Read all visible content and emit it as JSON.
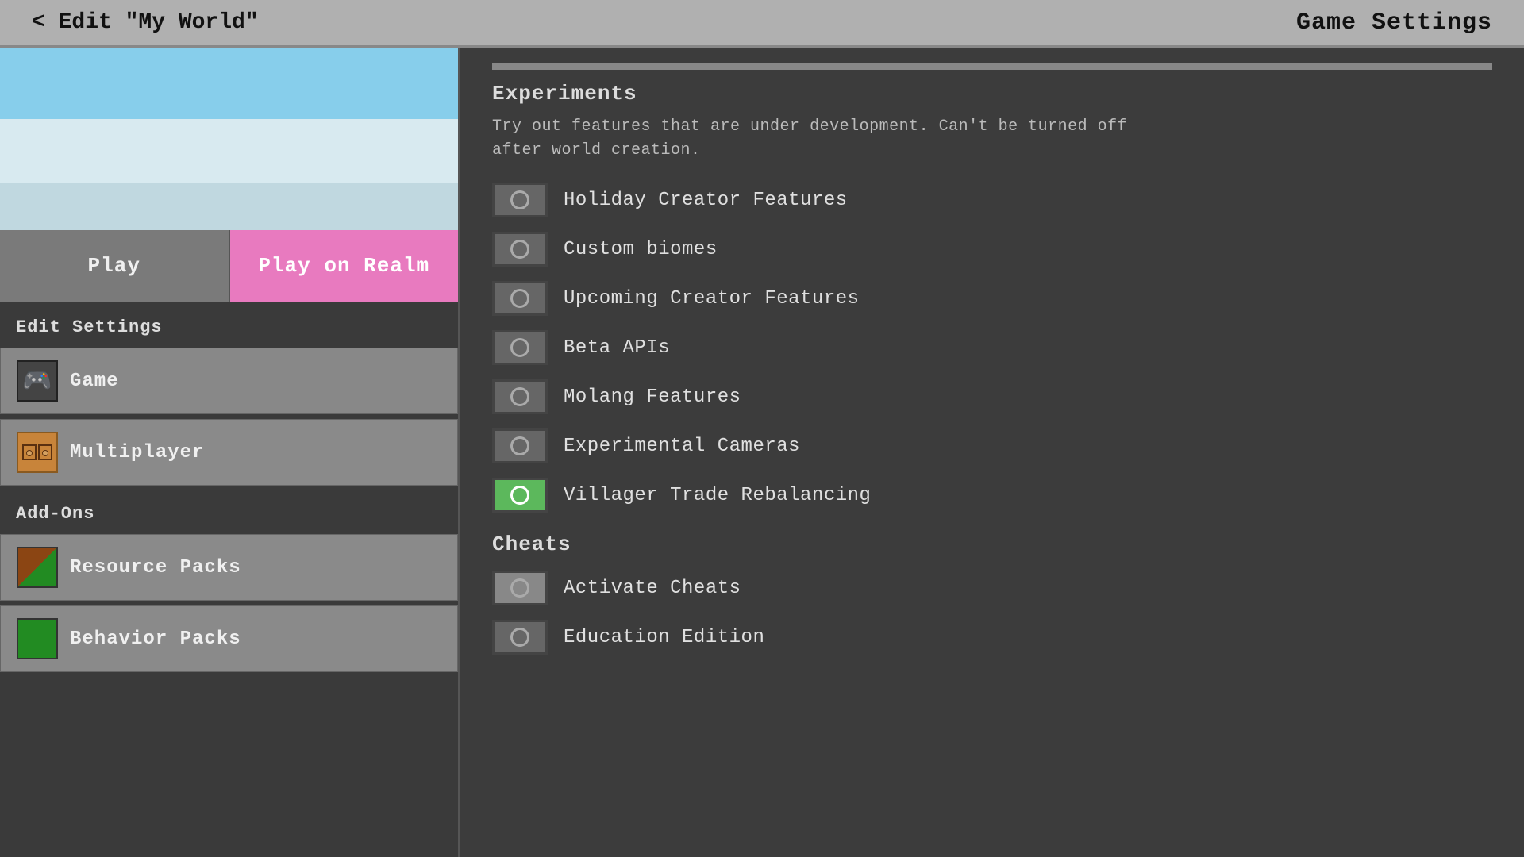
{
  "header": {
    "back_label": "< Edit \"My World\"",
    "title": "Game Settings"
  },
  "left_panel": {
    "play_button": "Play",
    "play_realm_button": "Play on Realm",
    "edit_settings_label": "Edit Settings",
    "settings_items": [
      {
        "id": "game",
        "label": "Game",
        "icon": "controller"
      },
      {
        "id": "multiplayer",
        "label": "Multiplayer",
        "icon": "multiplayer"
      }
    ],
    "addons_label": "Add-Ons",
    "addon_items": [
      {
        "id": "resource-packs",
        "label": "Resource Packs",
        "icon": "resource"
      },
      {
        "id": "behavior-packs",
        "label": "Behavior Packs",
        "icon": "behavior"
      }
    ]
  },
  "right_panel": {
    "scroll_line": true,
    "experiments_title": "Experiments",
    "experiments_desc": "Try out features that are under development. Can't be turned off after world creation.",
    "experiments": [
      {
        "id": "holiday-creator",
        "label": "Holiday Creator Features",
        "state": "off"
      },
      {
        "id": "custom-biomes",
        "label": "Custom biomes",
        "state": "off"
      },
      {
        "id": "upcoming-creator",
        "label": "Upcoming Creator Features",
        "state": "off"
      },
      {
        "id": "beta-apis",
        "label": "Beta APIs",
        "state": "off"
      },
      {
        "id": "molang",
        "label": "Molang Features",
        "state": "off"
      },
      {
        "id": "exp-cameras",
        "label": "Experimental Cameras",
        "state": "off"
      },
      {
        "id": "villager-trade",
        "label": "Villager Trade Rebalancing",
        "state": "on"
      }
    ],
    "cheats_title": "Cheats",
    "cheats": [
      {
        "id": "activate-cheats",
        "label": "Activate Cheats",
        "state": "active"
      },
      {
        "id": "education-edition",
        "label": "Education Edition",
        "state": "off"
      }
    ]
  }
}
